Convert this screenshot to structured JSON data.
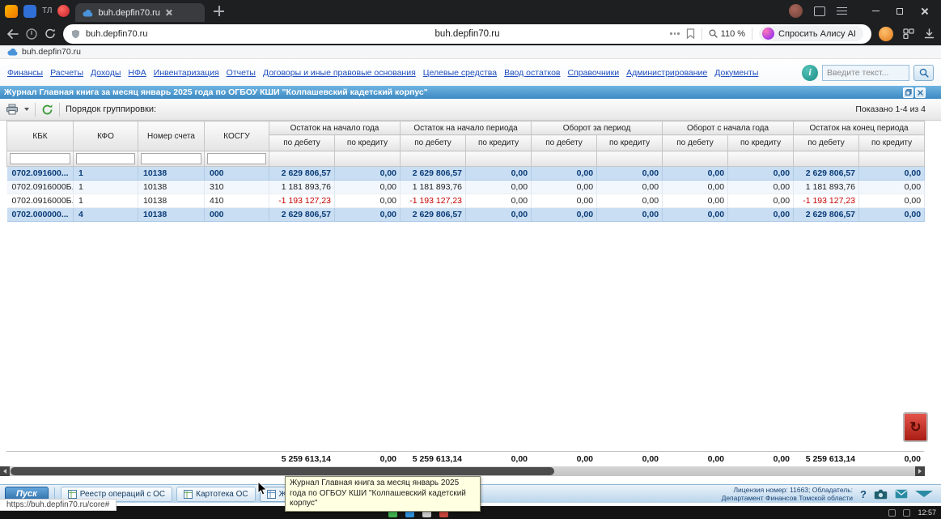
{
  "browser": {
    "tab_strip_label": "ТЛ",
    "active_tab": "buh.depfin70.ru",
    "url_left": "buh.depfin70.ru",
    "url_center": "buh.depfin70.ru",
    "zoom_label": "110 %",
    "alice_label": "Спросить Алису AI",
    "bookmark_label": "buh.depfin70.ru",
    "status_link": "https://buh.depfin70.ru/core#"
  },
  "menu": {
    "items": [
      "Финансы",
      "Расчеты",
      "Доходы",
      "НФА",
      "Инвентаризация",
      "Отчеты",
      "Договоры и иные правовые основания",
      "Целевые средства",
      "Ввод остатков",
      "Справочники",
      "Администрирование",
      "Документы"
    ],
    "search_placeholder": "Введите текст...",
    "info_label": "i"
  },
  "window": {
    "title": "Журнал Главная книга за месяц январь 2025 года по ОГБОУ КШИ \"Колпашевский кадетский корпус\""
  },
  "toolbar": {
    "grouping_label": "Порядок группировки:",
    "range_label": "Показано 1-4 из 4"
  },
  "table": {
    "groups": [
      "Остаток на начало года",
      "Остаток на начало периода",
      "Оборот за период",
      "Оборот с начала года",
      "Остаток на конец периода"
    ],
    "key_columns": [
      "КБК",
      "КФО",
      "Номер счета",
      "КОСГУ"
    ],
    "debit_label": "по дебету",
    "credit_label": "по кредиту",
    "rows": [
      {
        "kbk": "0702.091600...",
        "kfo": "1",
        "account": "10138",
        "kosgu": "000",
        "values": [
          "2 629 806,57",
          "0,00",
          "2 629 806,57",
          "0,00",
          "0,00",
          "0,00",
          "0,00",
          "0,00",
          "2 629 806,57",
          "0,00"
        ]
      },
      {
        "kbk": "0702.0916000Б...",
        "kfo": "1",
        "account": "10138",
        "kosgu": "310",
        "values": [
          "1 181 893,76",
          "0,00",
          "1 181 893,76",
          "0,00",
          "0,00",
          "0,00",
          "0,00",
          "0,00",
          "1 181 893,76",
          "0,00"
        ]
      },
      {
        "kbk": "0702.0916000Б...",
        "kfo": "1",
        "account": "10138",
        "kosgu": "410",
        "values": [
          "-1 193 127,23",
          "0,00",
          "-1 193 127,23",
          "0,00",
          "0,00",
          "0,00",
          "0,00",
          "0,00",
          "-1 193 127,23",
          "0,00"
        ]
      },
      {
        "kbk": "0702.000000...",
        "kfo": "4",
        "account": "10138",
        "kosgu": "000",
        "values": [
          "2 629 806,57",
          "0,00",
          "2 629 806,57",
          "0,00",
          "0,00",
          "0,00",
          "0,00",
          "0,00",
          "2 629 806,57",
          "0,00"
        ]
      }
    ],
    "totals": [
      "5 259 613,14",
      "0,00",
      "5 259 613,14",
      "0,00",
      "0,00",
      "0,00",
      "0,00",
      "0,00",
      "5 259 613,14",
      "0,00"
    ]
  },
  "tooltip": {
    "text": "Журнал Главная книга за месяц январь 2025 года по ОГБОУ КШИ \"Колпашевский кадетский корпус\""
  },
  "bottombar": {
    "start_label": "Пуск",
    "tabs": [
      "Реестр операций с ОС",
      "Картотека ОС",
      "Журнал Главная книга за ме..."
    ],
    "license_line1": "Лицензия номер: 11663; Обладатель:",
    "license_line2": "Департамент Финансов Томской области",
    "help_label": "?"
  },
  "taskbar": {
    "time": "12:57"
  }
}
